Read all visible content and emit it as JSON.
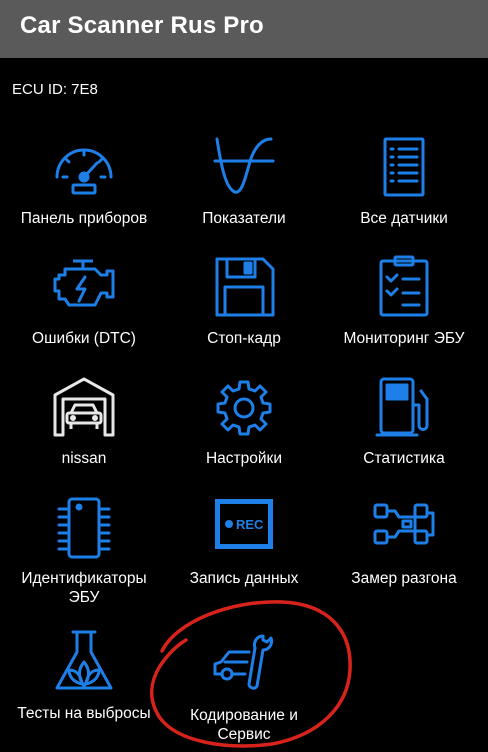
{
  "app": {
    "title": "Car Scanner Rus Pro"
  },
  "ecu": {
    "label": "ECU ID: 7E8"
  },
  "tiles": [
    {
      "label": "Панель приборов",
      "icon": "gauge-icon"
    },
    {
      "label": "Показатели",
      "icon": "waveform-icon"
    },
    {
      "label": "Все датчики",
      "icon": "list-icon"
    },
    {
      "label": "Ошибки (DTC)",
      "icon": "engine-icon"
    },
    {
      "label": "Стоп-кадр",
      "icon": "floppy-disk-icon"
    },
    {
      "label": "Мониторинг ЭБУ",
      "icon": "checklist-icon"
    },
    {
      "label": "nissan",
      "icon": "garage-car-icon"
    },
    {
      "label": "Настройки",
      "icon": "gear-icon"
    },
    {
      "label": "Статистика",
      "icon": "fuel-pump-icon"
    },
    {
      "label": "Идентификаторы ЭБУ",
      "icon": "chip-icon"
    },
    {
      "label": "Запись данных",
      "icon": "record-icon",
      "badge": "REC"
    },
    {
      "label": "Замер разгона",
      "icon": "race-car-icon"
    },
    {
      "label": "Тесты на выбросы",
      "icon": "flask-leaf-icon"
    },
    {
      "label": "Кодирование и Сервис",
      "icon": "car-wrench-icon"
    }
  ],
  "colors": {
    "accent": "#1e7fe8",
    "appbar": "#5a5a5a",
    "annotation": "#d8231c"
  }
}
